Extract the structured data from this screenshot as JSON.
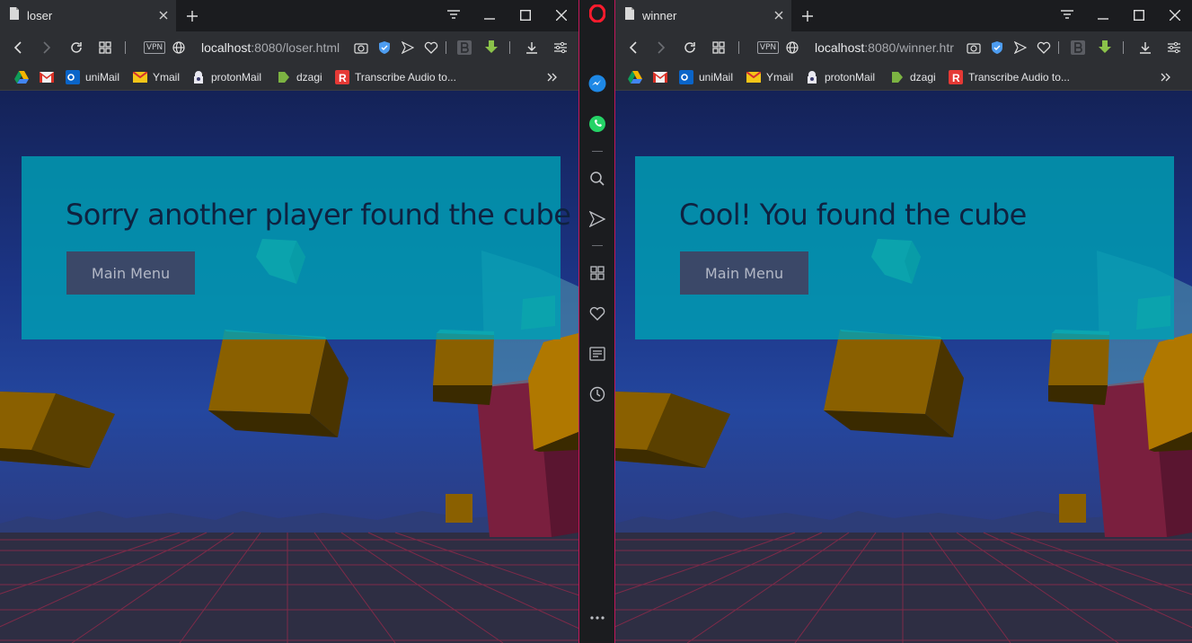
{
  "sidebar": {
    "items": [
      "opera-logo",
      "messenger-icon",
      "whatsapp-icon",
      "search-icon",
      "send-icon",
      "speed-dial-icon",
      "heart-icon",
      "news-icon",
      "history-icon",
      "more-icon"
    ]
  },
  "windows": [
    {
      "tab_title": "loser",
      "url_host": "localhost",
      "url_path": ":8080/loser.html",
      "vpn_label": "VPN",
      "bookmarks": [
        {
          "label": "",
          "icon": "google-drive-icon"
        },
        {
          "label": "",
          "icon": "gmail-icon"
        },
        {
          "label": "uniMail",
          "icon": "outlook-icon"
        },
        {
          "label": "Ymail",
          "icon": "ymail-icon"
        },
        {
          "label": "protonMail",
          "icon": "protonmail-icon"
        },
        {
          "label": "dzagi",
          "icon": "dzagi-icon"
        },
        {
          "label": "Transcribe Audio to...",
          "icon": "transcribe-icon"
        }
      ],
      "panel": {
        "headline": "Sorry another player found the cube",
        "button_label": "Main Menu"
      }
    },
    {
      "tab_title": "winner",
      "url_host": "localhost",
      "url_path": ":8080/winner.htr",
      "vpn_label": "VPN",
      "bookmarks": [
        {
          "label": "",
          "icon": "google-drive-icon"
        },
        {
          "label": "",
          "icon": "gmail-icon"
        },
        {
          "label": "uniMail",
          "icon": "outlook-icon"
        },
        {
          "label": "Ymail",
          "icon": "ymail-icon"
        },
        {
          "label": "protonMail",
          "icon": "protonmail-icon"
        },
        {
          "label": "dzagi",
          "icon": "dzagi-icon"
        },
        {
          "label": "Transcribe Audio to...",
          "icon": "transcribe-icon"
        }
      ],
      "panel": {
        "headline": "Cool! You found the cube",
        "button_label": "Main Menu"
      }
    }
  ],
  "colors": {
    "panel": "#00a0b4",
    "button": "#3b4868",
    "sky_top": "#142257",
    "grid": "#8c2a4a",
    "cube_gold": "#8a6000",
    "cube_green": "#3fb28c",
    "pillar": "#7a1f3e"
  }
}
